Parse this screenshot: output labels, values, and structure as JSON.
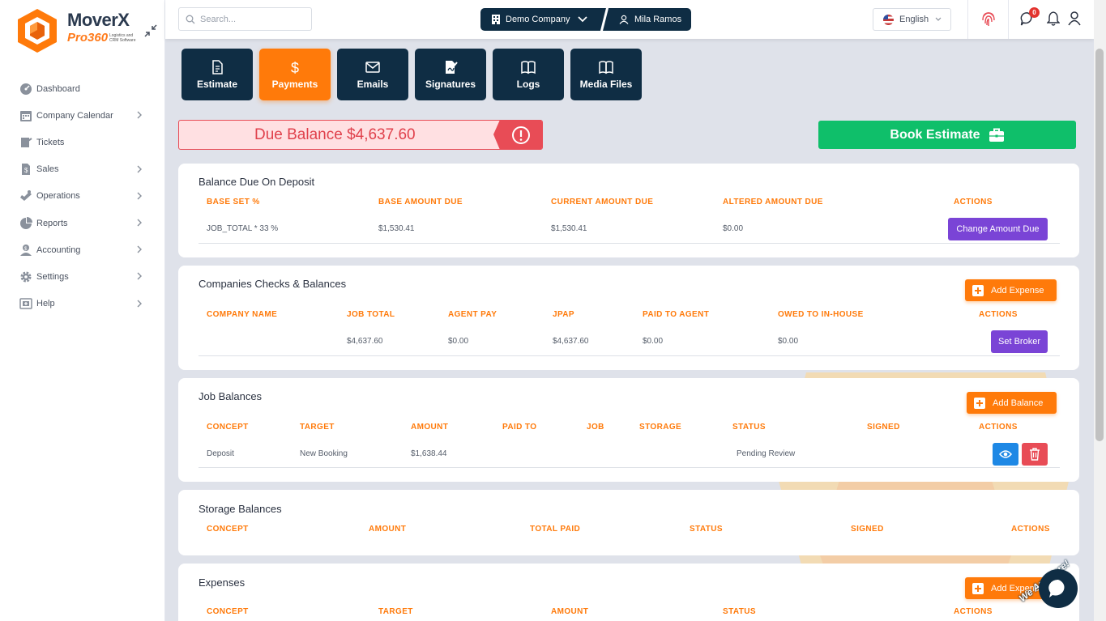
{
  "brand": {
    "title": "MoverX",
    "subtitle": "Pro360",
    "tagline": "Logistics and CRM Software"
  },
  "sidebar": {
    "items": [
      {
        "label": "Dashboard",
        "icon": "dashboard-icon",
        "has_children": false
      },
      {
        "label": "Company Calendar",
        "icon": "calendar-icon",
        "has_children": true
      },
      {
        "label": "Tickets",
        "icon": "ticket-icon",
        "has_children": false
      },
      {
        "label": "Sales",
        "icon": "sales-icon",
        "has_children": true
      },
      {
        "label": "Operations",
        "icon": "operations-icon",
        "has_children": true
      },
      {
        "label": "Reports",
        "icon": "reports-icon",
        "has_children": true
      },
      {
        "label": "Accounting",
        "icon": "accounting-icon",
        "has_children": true
      },
      {
        "label": "Settings",
        "icon": "gear-icon",
        "has_children": true
      },
      {
        "label": "Help",
        "icon": "help-icon",
        "has_children": true
      }
    ]
  },
  "topbar": {
    "search_placeholder": "Search...",
    "company": "Demo Company",
    "user": "Mila Ramos",
    "language": "English",
    "notification_count": "0"
  },
  "tabs": [
    {
      "label": "Estimate",
      "active": false
    },
    {
      "label": "Payments",
      "active": true
    },
    {
      "label": "Emails",
      "active": false
    },
    {
      "label": "Signatures",
      "active": false
    },
    {
      "label": "Logs",
      "active": false
    },
    {
      "label": "Media Files",
      "active": false
    }
  ],
  "due_balance": {
    "label": "Due Balance $4,637.60"
  },
  "book_estimate": {
    "label": "Book Estimate"
  },
  "balance_due_on_deposit": {
    "title": "Balance Due On Deposit",
    "headers": [
      "BASE SET %",
      "BASE AMOUNT DUE",
      "CURRENT AMOUNT DUE",
      "ALTERED AMOUNT DUE",
      "ACTIONS"
    ],
    "row": [
      "JOB_TOTAL * 33 %",
      "$1,530.41",
      "$1,530.41",
      "$0.00"
    ],
    "action_label": "Change Amount Due"
  },
  "companies_checks": {
    "title": "Companies Checks & Balances",
    "add_label": "Add Expense",
    "headers": [
      "COMPANY NAME",
      "JOB TOTAL",
      "AGENT PAY",
      "JPAP",
      "PAID TO AGENT",
      "OWED TO IN-HOUSE",
      "ACTIONS"
    ],
    "row": [
      "",
      "$4,637.60",
      "$0.00",
      "$4,637.60",
      "$0.00",
      "$0.00"
    ],
    "action_label": "Set Broker"
  },
  "job_balances": {
    "title": "Job Balances",
    "add_label": "Add Balance",
    "headers": [
      "CONCEPT",
      "TARGET",
      "AMOUNT",
      "PAID TO",
      "JOB",
      "STORAGE",
      "STATUS",
      "SIGNED",
      "ACTIONS"
    ],
    "row": [
      "Deposit",
      "New Booking",
      "$1,638.44",
      "",
      "",
      "",
      "Pending Review",
      ""
    ]
  },
  "storage_balances": {
    "title": "Storage Balances",
    "headers": [
      "CONCEPT",
      "AMOUNT",
      "TOTAL PAID",
      "STATUS",
      "SIGNED",
      "ACTIONS"
    ]
  },
  "expenses": {
    "title": "Expenses",
    "add_label": "Add Expense",
    "headers": [
      "CONCEPT",
      "TARGET",
      "AMOUNT",
      "STATUS",
      "ACTIONS"
    ]
  },
  "chat": {
    "label": "We Are Here!"
  },
  "colors": {
    "accent": "#ff7a0a",
    "navy": "#0f2d44",
    "danger": "#e84c56",
    "success": "#0fbf6a",
    "purple": "#7a44d6",
    "info": "#1e88e5"
  }
}
